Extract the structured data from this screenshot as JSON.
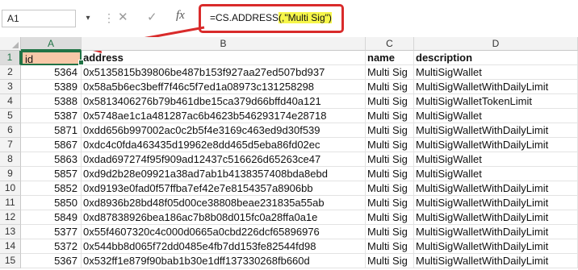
{
  "formula_bar": {
    "name_box": "A1",
    "name_box_arrow": "▾",
    "separator": "⋮",
    "cancel_icon": "✕",
    "enter_icon": "✓",
    "fx_label": "fx",
    "formula_prefix": "=CS.ADDRESS",
    "formula_highlight": "(,\"Multi Sig\")",
    "highlight_color": "#f6f64a",
    "annotation_color": "#d92b2b"
  },
  "columns": [
    "A",
    "B",
    "C",
    "D"
  ],
  "header": {
    "id": "id",
    "address": "address",
    "name": "name",
    "description": "description"
  },
  "rows": [
    {
      "num": "1"
    },
    {
      "num": "2",
      "id": "5364",
      "address": "0x5135815b39806be487b153f927aa27ed507bd937",
      "name": "Multi Sig",
      "description": "MultiSigWallet"
    },
    {
      "num": "3",
      "id": "5389",
      "address": "0x58a5b6ec3beff7f46c5f7ed1a08973c131258298",
      "name": "Multi Sig",
      "description": "MultiSigWalletWithDailyLimit"
    },
    {
      "num": "4",
      "id": "5388",
      "address": "0x5813406276b79b461dbe15ca379d66bffd40a121",
      "name": "Multi Sig",
      "description": "MultiSigWalletTokenLimit"
    },
    {
      "num": "5",
      "id": "5387",
      "address": "0x5748ae1c1a481287ac6b4623b546293174e28718",
      "name": "Multi Sig",
      "description": "MultiSigWallet"
    },
    {
      "num": "6",
      "id": "5871",
      "address": "0xdd656b997002ac0c2b5f4e3169c463ed9d30f539",
      "name": "Multi Sig",
      "description": "MultiSigWalletWithDailyLimit"
    },
    {
      "num": "7",
      "id": "5867",
      "address": "0xdc4c0fda463435d19962e8dd465d5eba86fd02ec",
      "name": "Multi Sig",
      "description": "MultiSigWalletWithDailyLimit"
    },
    {
      "num": "8",
      "id": "5863",
      "address": "0xdad697274f95f909ad12437c516626d65263ce47",
      "name": "Multi Sig",
      "description": "MultiSigWallet"
    },
    {
      "num": "9",
      "id": "5857",
      "address": "0xd9d2b28e09921a38ad7ab1b4138357408bda8ebd",
      "name": "Multi Sig",
      "description": "MultiSigWallet"
    },
    {
      "num": "10",
      "id": "5852",
      "address": "0xd9193e0fad0f57ffba7ef42e7e8154357a8906bb",
      "name": "Multi Sig",
      "description": "MultiSigWalletWithDailyLimit"
    },
    {
      "num": "11",
      "id": "5850",
      "address": "0xd8936b28bd48f05d00ce38808beae231835a55ab",
      "name": "Multi Sig",
      "description": "MultiSigWalletWithDailyLimit"
    },
    {
      "num": "12",
      "id": "5849",
      "address": "0xd87838926bea186ac7b8b08d015fc0a28ffa0a1e",
      "name": "Multi Sig",
      "description": "MultiSigWalletWithDailyLimit"
    },
    {
      "num": "13",
      "id": "5377",
      "address": "0x55f4607320c4c000d0665a0cbd226dcf65896976",
      "name": "Multi Sig",
      "description": "MultiSigWalletWithDailyLimit"
    },
    {
      "num": "14",
      "id": "5372",
      "address": "0x544bb8d065f72dd0485e4fb7dd153fe82544fd98",
      "name": "Multi Sig",
      "description": "MultiSigWalletWithDailyLimit"
    },
    {
      "num": "15",
      "id": "5367",
      "address": "0x532ff1e879f90bab1b30e1dff137330268fb660d",
      "name": "Multi Sig",
      "description": "MultiSigWalletWithDailyLimit"
    }
  ]
}
